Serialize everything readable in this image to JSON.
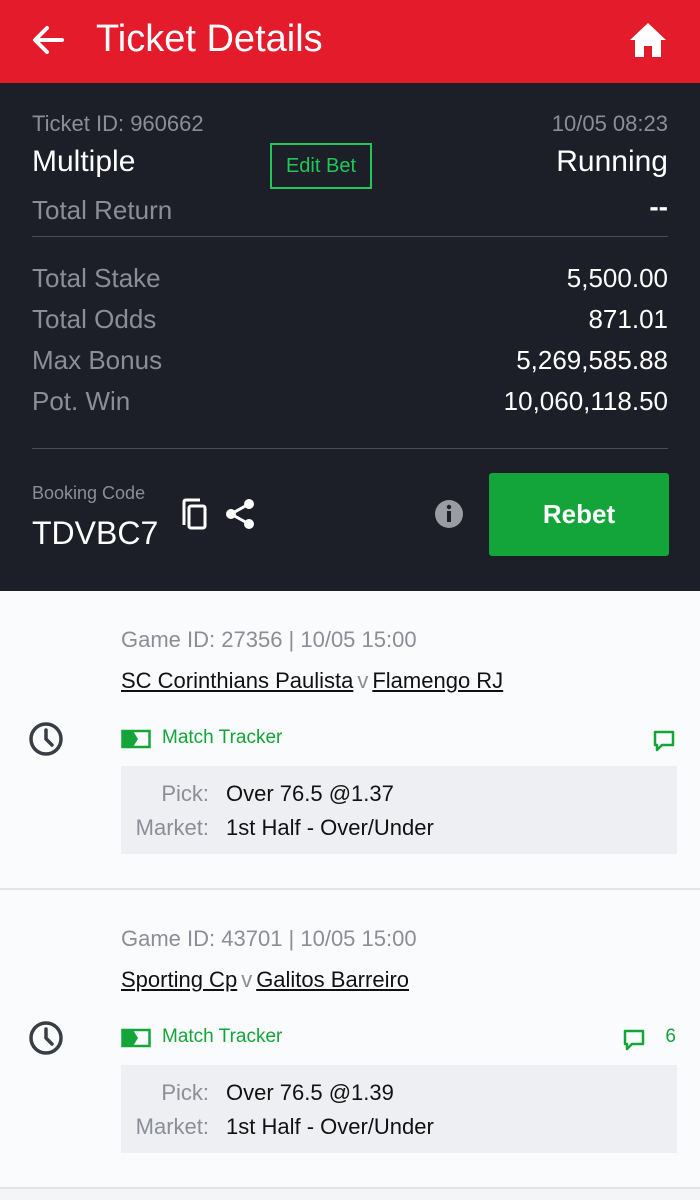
{
  "header": {
    "title": "Ticket Details",
    "back_icon": "arrow-left-icon",
    "home_icon": "home-icon"
  },
  "ticket": {
    "id_text": "Ticket ID: 960662",
    "date": "10/05 08:23",
    "type": "Multiple",
    "edit_label": "Edit Bet",
    "status": "Running",
    "total_return_label": "Total Return",
    "total_return_value": "--",
    "rows": [
      {
        "label": "Total Stake",
        "value": "5,500.00"
      },
      {
        "label": "Total Odds",
        "value": "871.01"
      },
      {
        "label": "Max Bonus",
        "value": "5,269,585.88"
      },
      {
        "label": "Pot. Win",
        "value": "10,060,118.50"
      }
    ],
    "booking_label": "Booking Code",
    "booking_code": "TDVBC7",
    "rebet_label": "Rebet"
  },
  "games": [
    {
      "game_id_text": "Game ID: 27356 | 10/05 15:00",
      "home": "SC Corinthians Paulista",
      "vs": "v",
      "away": "Flamengo RJ",
      "tracker_label": "Match Tracker",
      "comment_count": "",
      "pick_label": "Pick:",
      "pick": "Over 76.5 @1.37",
      "market_label": "Market:",
      "market": "1st Half - Over/Under"
    },
    {
      "game_id_text": "Game ID: 43701 | 10/05 15:00",
      "home": "Sporting Cp",
      "vs": "v",
      "away": "Galitos Barreiro",
      "tracker_label": "Match Tracker",
      "comment_count": "6",
      "pick_label": "Pick:",
      "pick": "Over 76.5 @1.39",
      "market_label": "Market:",
      "market": "1st Half - Over/Under"
    }
  ],
  "colors": {
    "brand_red": "#e41b2b",
    "dark_bg": "#1c1f27",
    "green": "#13a53a",
    "edit_green": "#21c75a"
  }
}
